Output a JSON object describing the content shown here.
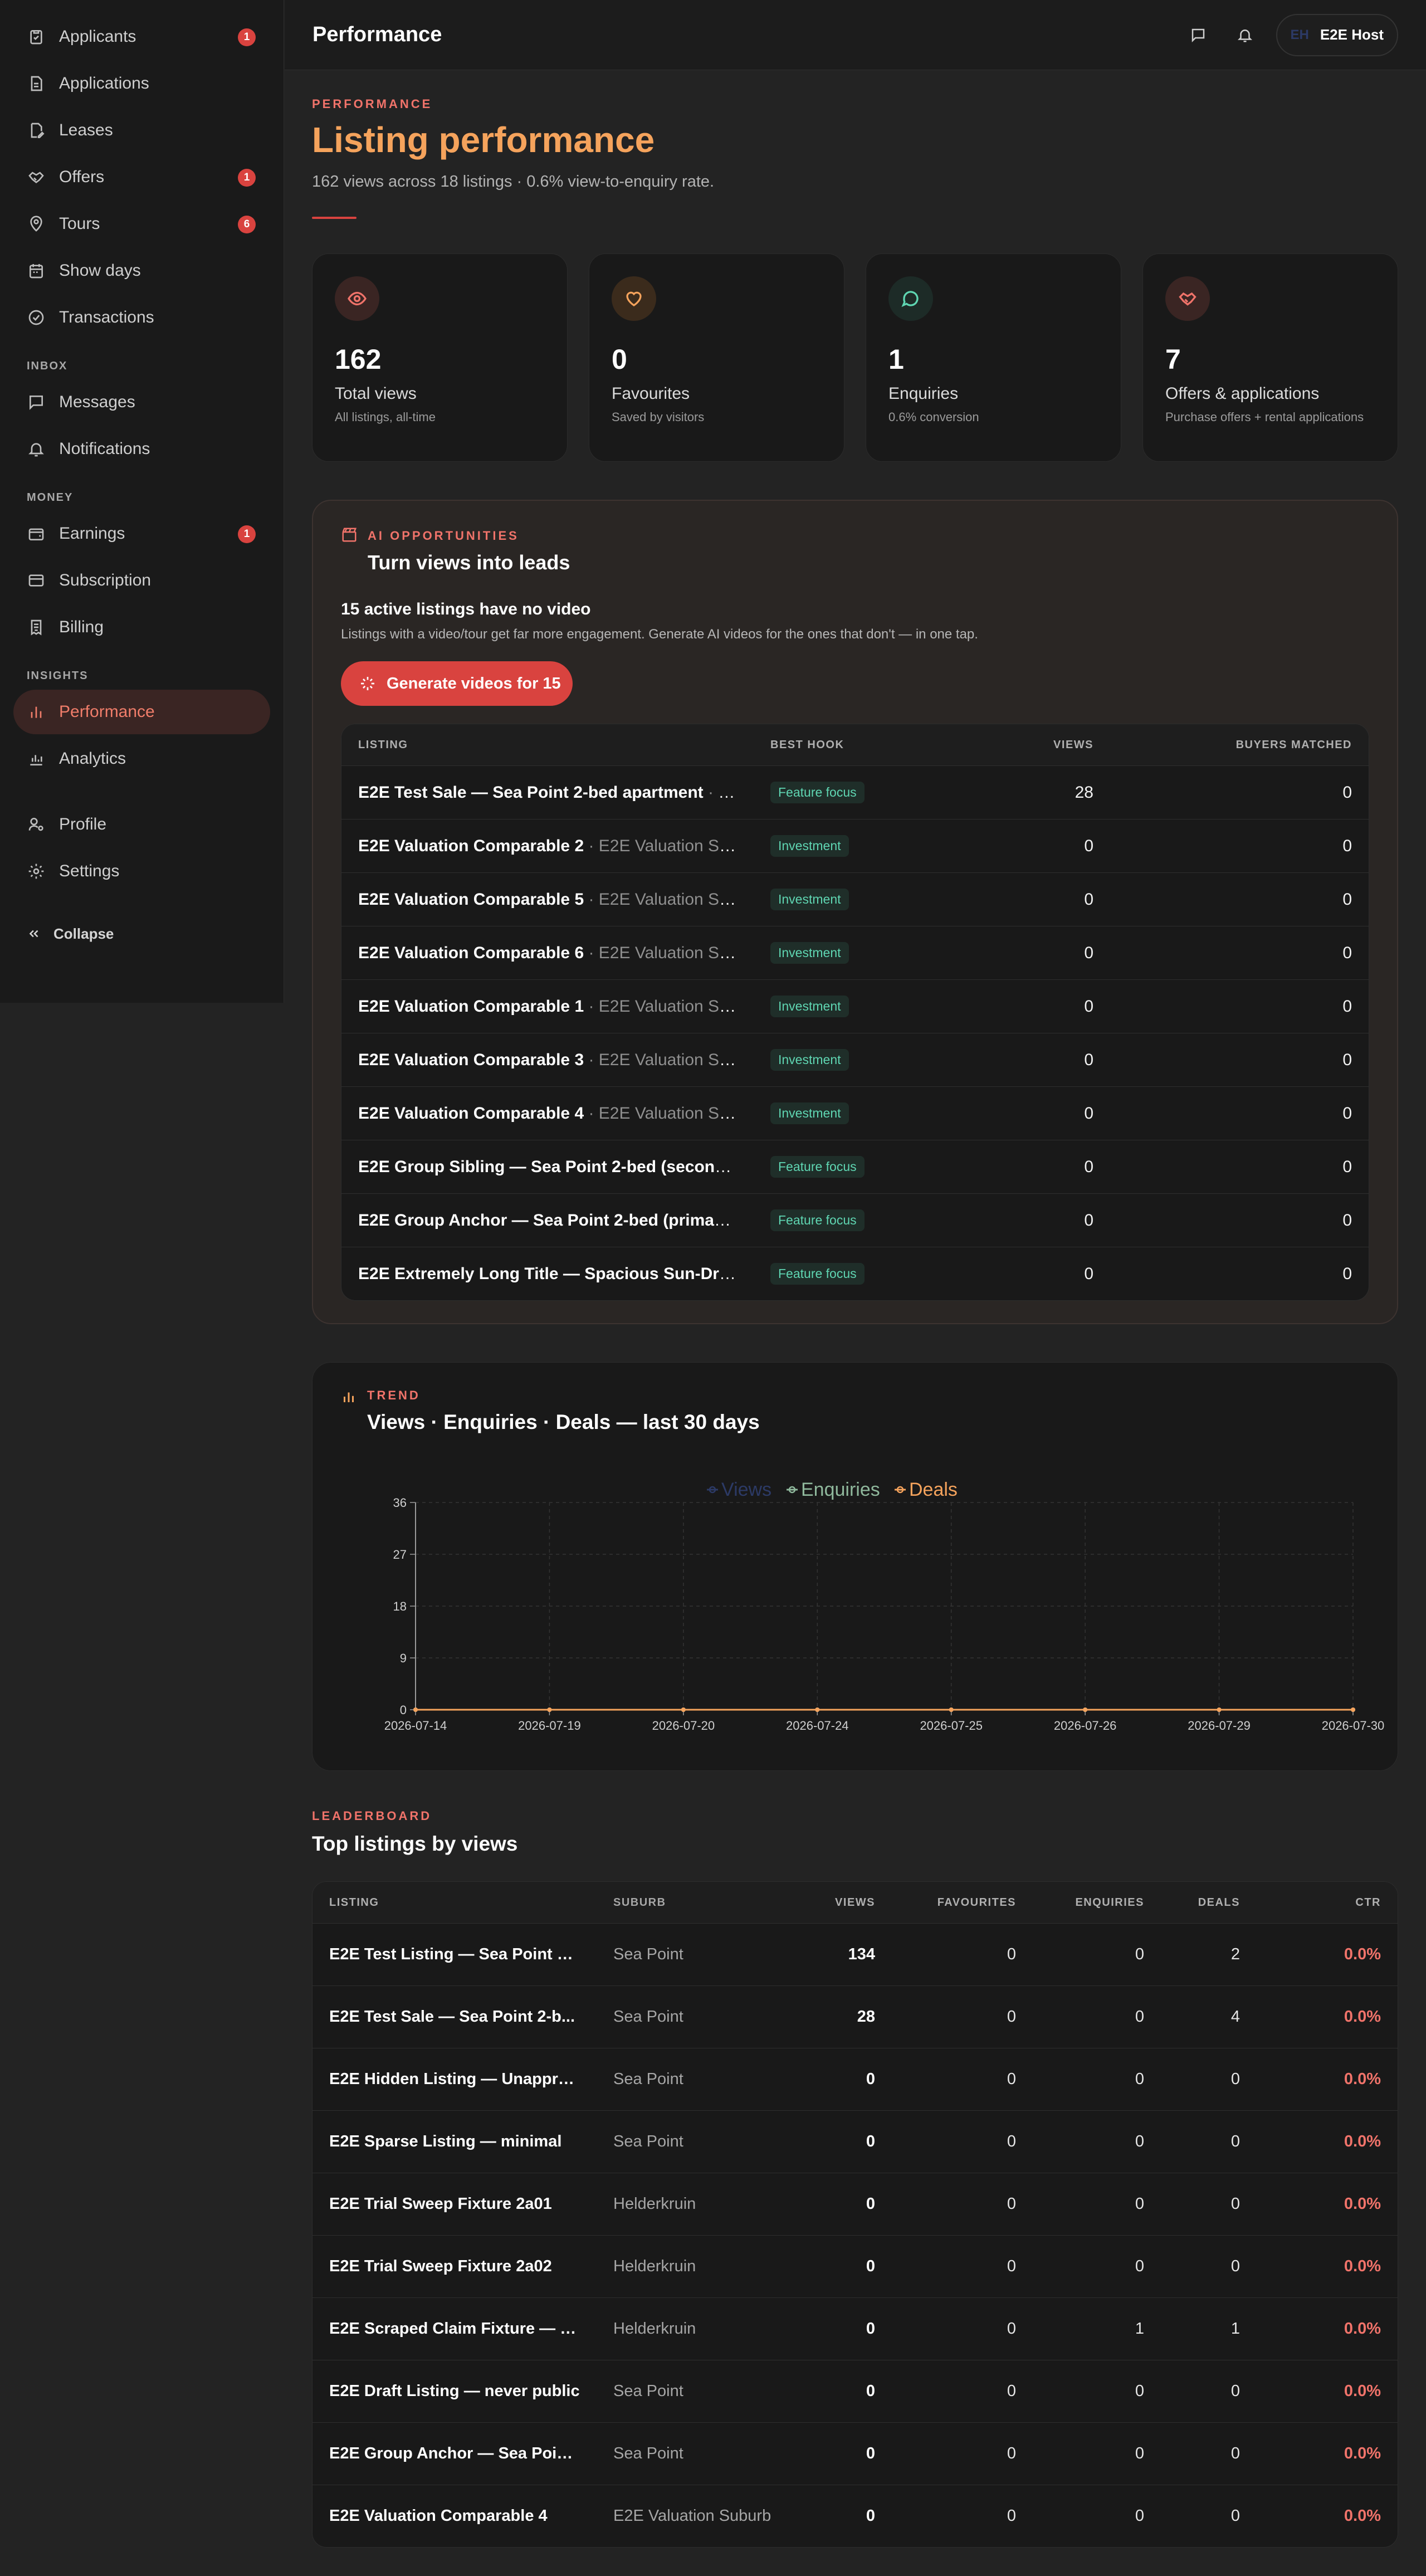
{
  "sidebar": {
    "items_top": [
      {
        "name": "applicants",
        "label": "Applicants",
        "icon": "clipboard-check-icon",
        "badge": "1"
      },
      {
        "name": "applications",
        "label": "Applications",
        "icon": "document-icon",
        "badge": null
      },
      {
        "name": "leases",
        "label": "Leases",
        "icon": "file-pen-icon",
        "badge": null
      },
      {
        "name": "offers",
        "label": "Offers",
        "icon": "handshake-icon",
        "badge": "1"
      },
      {
        "name": "tours",
        "label": "Tours",
        "icon": "map-pin-icon",
        "badge": "6"
      },
      {
        "name": "show-days",
        "label": "Show days",
        "icon": "calendar-icon",
        "badge": null
      },
      {
        "name": "transactions",
        "label": "Transactions",
        "icon": "check-circle-icon",
        "badge": null
      }
    ],
    "section_inbox": "INBOX",
    "items_inbox": [
      {
        "name": "messages",
        "label": "Messages",
        "icon": "message-icon",
        "badge": null
      },
      {
        "name": "notifications",
        "label": "Notifications",
        "icon": "bell-icon",
        "badge": null
      }
    ],
    "section_money": "MONEY",
    "items_money": [
      {
        "name": "earnings",
        "label": "Earnings",
        "icon": "wallet-icon",
        "badge": "1"
      },
      {
        "name": "subscription",
        "label": "Subscription",
        "icon": "credit-card-icon",
        "badge": null
      },
      {
        "name": "billing",
        "label": "Billing",
        "icon": "receipt-icon",
        "badge": null
      }
    ],
    "section_insights": "INSIGHTS",
    "items_insights": [
      {
        "name": "performance",
        "label": "Performance",
        "icon": "bar-chart-icon",
        "badge": null,
        "active": true
      },
      {
        "name": "analytics",
        "label": "Analytics",
        "icon": "analytics-icon",
        "badge": null
      }
    ],
    "items_bottom": [
      {
        "name": "profile",
        "label": "Profile",
        "icon": "user-cog-icon",
        "badge": null
      },
      {
        "name": "settings",
        "label": "Settings",
        "icon": "gear-icon",
        "badge": null
      }
    ],
    "collapse_label": "Collapse"
  },
  "topbar": {
    "title": "Performance",
    "user_initials": "EH",
    "user_name": "E2E Host"
  },
  "hero": {
    "eyebrow": "PERFORMANCE",
    "title": "Listing performance",
    "subtitle": "162 views across 18 listings · 0.6% view-to-enquiry rate."
  },
  "stats": [
    {
      "name": "total-views",
      "value": "162",
      "label": "Total views",
      "hint": "All listings, all-time",
      "icon": "eye-icon",
      "color": "#f0736a",
      "bg": "#3a2523"
    },
    {
      "name": "favourites",
      "value": "0",
      "label": "Favourites",
      "hint": "Saved by visitors",
      "icon": "heart-icon",
      "color": "#f5a35c",
      "bg": "#3b2b1c"
    },
    {
      "name": "enquiries",
      "value": "1",
      "label": "Enquiries",
      "hint": "0.6% conversion",
      "icon": "chat-bubble-icon",
      "color": "#5fd6b2",
      "bg": "#1d2b27"
    },
    {
      "name": "offers-applications",
      "value": "7",
      "label": "Offers & applications",
      "hint": "Purchase offers + rental applications",
      "icon": "handshake-icon",
      "color": "#f0736a",
      "bg": "#3a2523"
    }
  ],
  "ai": {
    "eyebrow": "AI OPPORTUNITIES",
    "title": "Turn views into leads",
    "count_text": "15 active listings have no video",
    "description": "Listings with a video/tour get far more engagement. Generate AI videos for the ones that don't — in one tap.",
    "button_label": "Generate videos for 15",
    "columns": [
      "LISTING",
      "BEST HOOK",
      "VIEWS",
      "BUYERS MATCHED"
    ],
    "rows": [
      {
        "name": "E2E Test Sale — Sea Point 2-bed apartment",
        "sub": " · Se...",
        "hook": "Feature focus",
        "views": "28",
        "matched": "0"
      },
      {
        "name": "E2E Valuation Comparable 2",
        "sub": " · E2E Valuation Sub...",
        "hook": "Investment",
        "views": "0",
        "matched": "0"
      },
      {
        "name": "E2E Valuation Comparable 5",
        "sub": " · E2E Valuation Sub...",
        "hook": "Investment",
        "views": "0",
        "matched": "0"
      },
      {
        "name": "E2E Valuation Comparable 6",
        "sub": " · E2E Valuation Sub...",
        "hook": "Investment",
        "views": "0",
        "matched": "0"
      },
      {
        "name": "E2E Valuation Comparable 1",
        "sub": " · E2E Valuation Sub...",
        "hook": "Investment",
        "views": "0",
        "matched": "0"
      },
      {
        "name": "E2E Valuation Comparable 3",
        "sub": " · E2E Valuation Sub...",
        "hook": "Investment",
        "views": "0",
        "matched": "0"
      },
      {
        "name": "E2E Valuation Comparable 4",
        "sub": " · E2E Valuation Sub...",
        "hook": "Investment",
        "views": "0",
        "matched": "0"
      },
      {
        "name": "E2E Group Sibling — Sea Point 2-bed (secondar...",
        "sub": "",
        "hook": "Feature focus",
        "views": "0",
        "matched": "0"
      },
      {
        "name": "E2E Group Anchor — Sea Point 2-bed (primary li...",
        "sub": "",
        "hook": "Feature focus",
        "views": "0",
        "matched": "0"
      },
      {
        "name": "E2E Extremely Long Title — Spacious Sun-Drenc...",
        "sub": "",
        "hook": "Feature focus",
        "views": "0",
        "matched": "0"
      }
    ]
  },
  "trend": {
    "eyebrow": "TREND",
    "title": "Views · Enquiries · Deals — last 30 days"
  },
  "chart_data": {
    "type": "line",
    "categories": [
      "2026-07-14",
      "2026-07-19",
      "2026-07-20",
      "2026-07-24",
      "2026-07-25",
      "2026-07-26",
      "2026-07-29",
      "2026-07-30"
    ],
    "series": [
      {
        "name": "Views",
        "color": "#2c3a66",
        "values": [
          0,
          0,
          0,
          0,
          0,
          0,
          0,
          0
        ]
      },
      {
        "name": "Enquiries",
        "color": "#8fb89c",
        "values": [
          0,
          0,
          0,
          0,
          0,
          0,
          0,
          0
        ]
      },
      {
        "name": "Deals",
        "color": "#f5a35c",
        "values": [
          0,
          0,
          0,
          0,
          0,
          0,
          0,
          0
        ]
      }
    ],
    "ylim": [
      0,
      36
    ],
    "yticks": [
      "0",
      "9",
      "18",
      "27",
      "36"
    ],
    "grid": true,
    "legend": "top-center"
  },
  "leaderboard": {
    "eyebrow": "LEADERBOARD",
    "title": "Top listings by views",
    "columns": [
      "LISTING",
      "SUBURB",
      "VIEWS",
      "FAVOURITES",
      "ENQUIRIES",
      "DEALS",
      "CTR"
    ],
    "rows": [
      {
        "listing": "E2E Test Listing — Sea Point 2-...",
        "suburb": "Sea Point",
        "views": "134",
        "fav": "0",
        "enq": "0",
        "deals": "2",
        "ctr": "0.0%"
      },
      {
        "listing": "E2E Test Sale — Sea Point 2-b...",
        "suburb": "Sea Point",
        "views": "28",
        "fav": "0",
        "enq": "0",
        "deals": "4",
        "ctr": "0.0%"
      },
      {
        "listing": "E2E Hidden Listing — Unappro...",
        "suburb": "Sea Point",
        "views": "0",
        "fav": "0",
        "enq": "0",
        "deals": "0",
        "ctr": "0.0%"
      },
      {
        "listing": "E2E Sparse Listing — minimal",
        "suburb": "Sea Point",
        "views": "0",
        "fav": "0",
        "enq": "0",
        "deals": "0",
        "ctr": "0.0%"
      },
      {
        "listing": "E2E Trial Sweep Fixture 2a01",
        "suburb": "Helderkruin",
        "views": "0",
        "fav": "0",
        "enq": "0",
        "deals": "0",
        "ctr": "0.0%"
      },
      {
        "listing": "E2E Trial Sweep Fixture 2a02",
        "suburb": "Helderkruin",
        "views": "0",
        "fav": "0",
        "enq": "0",
        "deals": "0",
        "ctr": "0.0%"
      },
      {
        "listing": "E2E Scraped Claim Fixture — P...",
        "suburb": "Helderkruin",
        "views": "0",
        "fav": "0",
        "enq": "1",
        "deals": "1",
        "ctr": "0.0%"
      },
      {
        "listing": "E2E Draft Listing — never public",
        "suburb": "Sea Point",
        "views": "0",
        "fav": "0",
        "enq": "0",
        "deals": "0",
        "ctr": "0.0%"
      },
      {
        "listing": "E2E Group Anchor — Sea Point...",
        "suburb": "Sea Point",
        "views": "0",
        "fav": "0",
        "enq": "0",
        "deals": "0",
        "ctr": "0.0%"
      },
      {
        "listing": "E2E Valuation Comparable 4",
        "suburb": "E2E Valuation Suburb",
        "views": "0",
        "fav": "0",
        "enq": "0",
        "deals": "0",
        "ctr": "0.0%"
      }
    ]
  }
}
